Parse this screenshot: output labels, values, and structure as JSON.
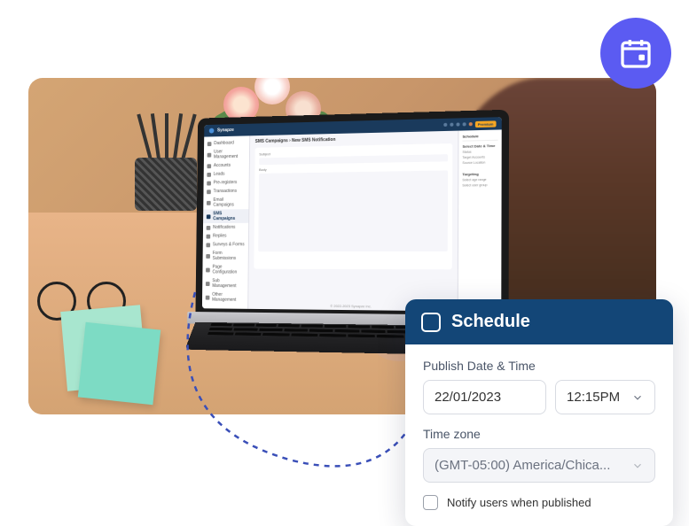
{
  "colors": {
    "primary": "#134677",
    "accent": "#5b5bf2"
  },
  "app": {
    "brand": "Synapze",
    "topbar_badge": "Premium",
    "breadcrumb": "SMS Campaigns › New SMS Notification",
    "main": {
      "field1_label": "Subject",
      "field2_label": "Body"
    },
    "sidebar": {
      "items": [
        {
          "label": "Dashboard"
        },
        {
          "label": "User Management"
        },
        {
          "label": "Accounts"
        },
        {
          "label": "Leads"
        },
        {
          "label": "Pre-registers"
        },
        {
          "label": "Transactions"
        },
        {
          "label": "Email Campaigns"
        },
        {
          "label": "SMS Campaigns"
        },
        {
          "label": "Notifications"
        },
        {
          "label": "Replies"
        },
        {
          "label": "Surveys & Forms"
        },
        {
          "label": "Form Submissions"
        },
        {
          "label": "Page Configuration"
        },
        {
          "label": "Sub Management"
        },
        {
          "label": "Other Management"
        }
      ],
      "active_index": 7
    },
    "rightpanel": {
      "title": "Schedule",
      "section1": "Select Date & Time",
      "items": [
        "Status",
        "Target Accounts",
        "Source Location",
        "",
        "Targeting",
        "Select age range",
        "Select user group"
      ]
    },
    "footer": "© 2022-2023 Synapze Inc."
  },
  "schedule": {
    "title": "Schedule",
    "publish_label": "Publish Date & Time",
    "date_value": "22/01/2023",
    "time_value": "12:15PM",
    "tz_label": "Time zone",
    "tz_value": "(GMT-05:00) America/Chica...",
    "notify_label": "Notify users when published",
    "notify_checked": false
  }
}
